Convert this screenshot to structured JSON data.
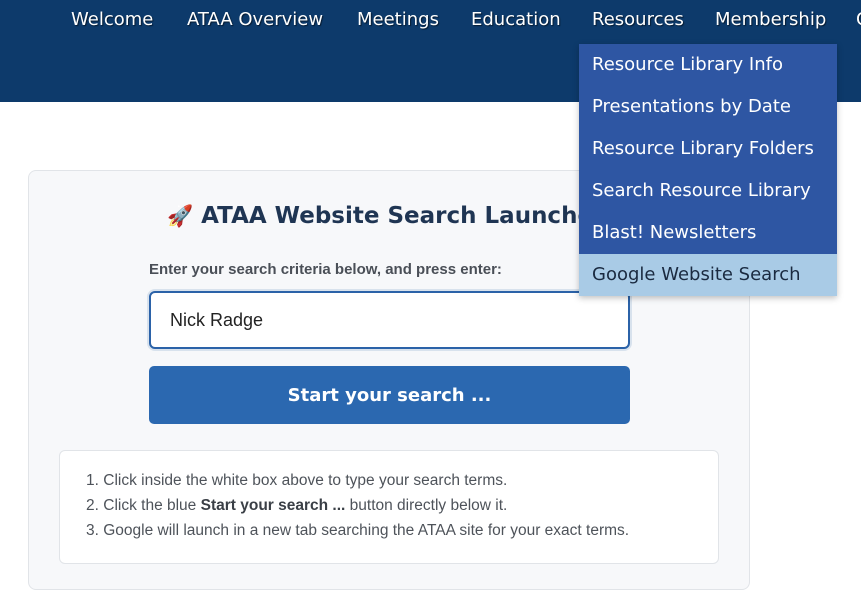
{
  "nav": {
    "items": [
      {
        "label": "Welcome"
      },
      {
        "label": "ATAA Overview"
      },
      {
        "label": "Meetings"
      },
      {
        "label": "Education"
      },
      {
        "label": "Resources"
      },
      {
        "label": "Membership"
      },
      {
        "label": "C"
      }
    ],
    "resources_menu": [
      {
        "label": "Resource Library Info"
      },
      {
        "label": "Presentations by Date"
      },
      {
        "label": "Resource Library Folders"
      },
      {
        "label": "Search Resource Library"
      },
      {
        "label": "Blast! Newsletters"
      },
      {
        "label": "Google Website Search"
      }
    ]
  },
  "search_launcher": {
    "icon": "rocket-icon",
    "title": "ATAA Website Search Launcher",
    "prompt": "Enter your search criteria below, and press enter:",
    "input_value": "Nick Radge",
    "button_label": "Start your search ...",
    "instructions": [
      {
        "num": "1.",
        "before": "Click inside the white box above to type your search terms.",
        "bold": "",
        "after": ""
      },
      {
        "num": "2.",
        "before": "Click the blue ",
        "bold": "Start your search ...",
        "after": " button directly below it."
      },
      {
        "num": "3.",
        "before": "Google will launch in a new tab searching the ATAA site for your exact terms.",
        "bold": "",
        "after": ""
      }
    ]
  },
  "colors": {
    "header_bg": "#0d3a6b",
    "dropdown_bg": "#2e56a3",
    "dropdown_active_bg": "#a9cbe6",
    "button_bg": "#2b68b0"
  }
}
